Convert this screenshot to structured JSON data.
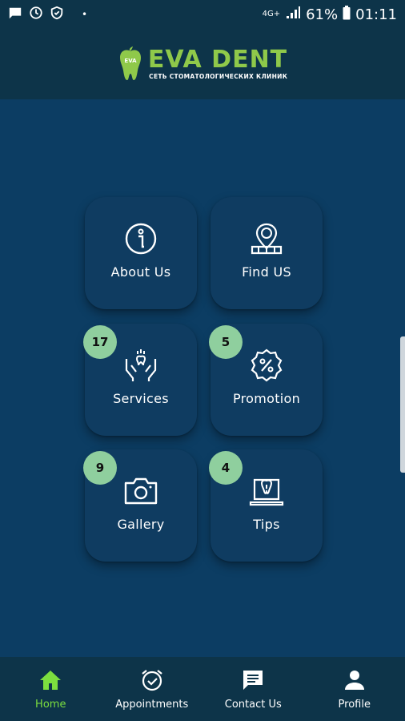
{
  "status_bar": {
    "network": "4G+",
    "battery": "61%",
    "time": "01:11",
    "icons": [
      "message-icon",
      "sync-icon",
      "shield-icon",
      "signal-icon",
      "battery-icon"
    ]
  },
  "header": {
    "brand_name": "EVA DENT",
    "brand_tagline": "СЕТЬ СТОМАТОЛОГИЧЕСКИХ КЛИНИК",
    "logo_badge": "EVA"
  },
  "tiles": [
    {
      "label": "About Us",
      "icon": "info-icon",
      "badge": null
    },
    {
      "label": "Find US",
      "icon": "location-phone-icon",
      "badge": null
    },
    {
      "label": "Services",
      "icon": "hands-tooth-icon",
      "badge": "17"
    },
    {
      "label": "Promotion",
      "icon": "discount-badge-icon",
      "badge": "5"
    },
    {
      "label": "Gallery",
      "icon": "camera-icon",
      "badge": "9"
    },
    {
      "label": "Tips",
      "icon": "laptop-tooth-icon",
      "badge": "4"
    }
  ],
  "nav": {
    "items": [
      {
        "label": "Home",
        "icon": "home-icon",
        "active": true
      },
      {
        "label": "Appointments",
        "icon": "alarm-clock-icon",
        "active": false
      },
      {
        "label": "Contact Us",
        "icon": "chat-icon",
        "active": false
      },
      {
        "label": "Profile",
        "icon": "person-icon",
        "active": false
      }
    ]
  },
  "colors": {
    "background": "#0c3d63",
    "bars": "#0d3449",
    "tile": "#0f3c61",
    "badge": "#8fcf9e",
    "brand_green": "#8fc94a",
    "nav_active": "#7cde3f"
  }
}
